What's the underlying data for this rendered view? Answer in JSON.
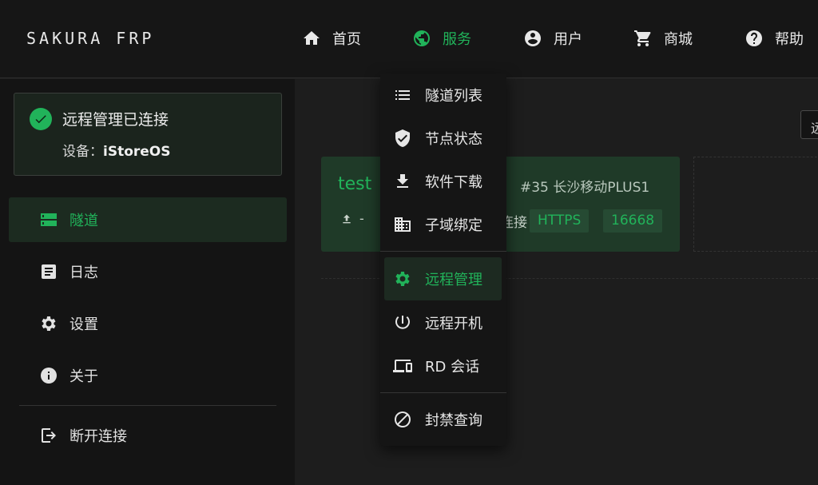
{
  "brand": "SAKURA FRP",
  "nav": [
    {
      "label": "首页",
      "icon": "home-icon"
    },
    {
      "label": "服务",
      "icon": "globe-icon"
    },
    {
      "label": "用户",
      "icon": "account-icon"
    },
    {
      "label": "商城",
      "icon": "cart-icon"
    },
    {
      "label": "帮助",
      "icon": "help-icon"
    }
  ],
  "status": {
    "title": "远程管理已连接",
    "device_label": "设备：",
    "device_name": "iStoreOS"
  },
  "sidebar": [
    {
      "label": "隧道",
      "icon": "tunnel-icon"
    },
    {
      "label": "日志",
      "icon": "log-icon"
    },
    {
      "label": "设置",
      "icon": "gear-icon"
    },
    {
      "label": "关于",
      "icon": "info-icon"
    },
    {
      "label": "断开连接",
      "icon": "logout-icon"
    }
  ],
  "dropdown": [
    {
      "label": "隧道列表",
      "icon": "list-icon"
    },
    {
      "label": "节点状态",
      "icon": "shield-check-icon"
    },
    {
      "label": "软件下载",
      "icon": "download-icon"
    },
    {
      "label": "子域绑定",
      "icon": "domain-icon"
    },
    {
      "label": "远程管理",
      "icon": "gear-icon"
    },
    {
      "label": "远程开机",
      "icon": "power-icon"
    },
    {
      "label": "RD 会话",
      "icon": "devices-icon"
    },
    {
      "label": "封禁查询",
      "icon": "block-icon"
    }
  ],
  "tunnel": {
    "name": "test",
    "node": "#35 长沙移动PLUS1",
    "upload": "-",
    "partial_text": "连接",
    "tags": [
      "HTTPS",
      "16668"
    ]
  },
  "right_button_partial": "远",
  "colors": {
    "accent": "#21b35a",
    "background": "#1e1e1e",
    "sidebar": "#141414"
  }
}
